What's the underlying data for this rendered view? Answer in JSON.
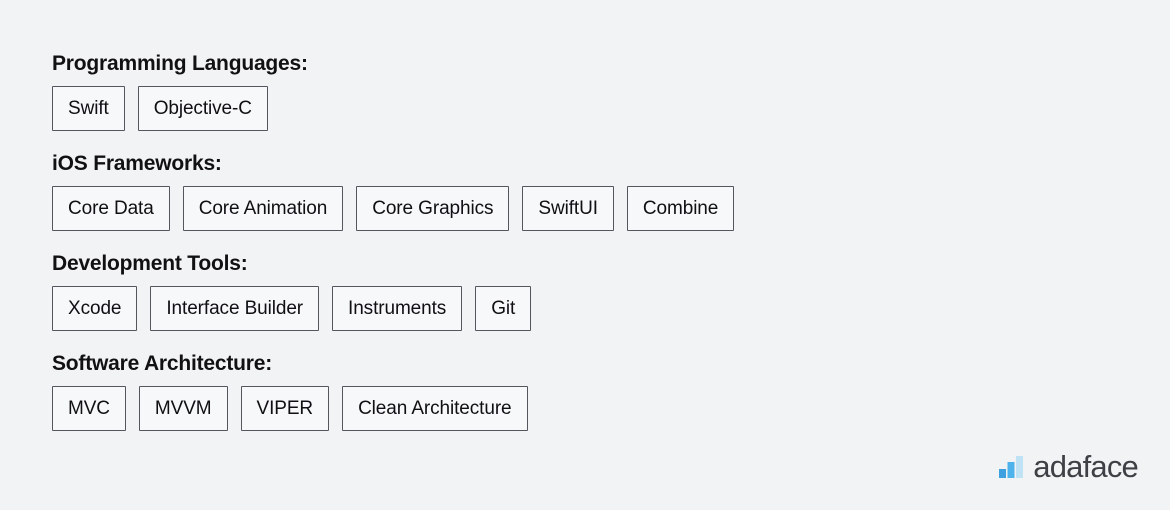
{
  "background_color": "#f2f3f5",
  "sections": [
    {
      "heading": "Programming Languages:",
      "chips": [
        "Swift",
        "Objective-C"
      ]
    },
    {
      "heading": "iOS Frameworks:",
      "chips": [
        "Core Data",
        "Core Animation",
        "Core Graphics",
        "SwiftUI",
        "Combine"
      ]
    },
    {
      "heading": "Development Tools:",
      "chips": [
        "Xcode",
        "Interface Builder",
        "Instruments",
        "Git"
      ]
    },
    {
      "heading": "Software Architecture:",
      "chips": [
        "MVC",
        "MVVM",
        "VIPER",
        "Clean Architecture"
      ]
    }
  ],
  "brand": {
    "name": "adaface",
    "mark_icon": "bar-chart-logo-icon",
    "mark_colors": [
      "#3fa0e0",
      "#4db3ea",
      "#bfe2f5"
    ],
    "text_color": "#3f4045"
  }
}
